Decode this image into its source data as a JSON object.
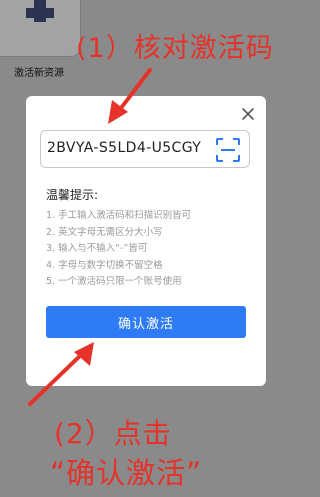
{
  "background": {
    "tile_label": "激活新资源"
  },
  "annotations": {
    "step1": "(1）核对激活码",
    "step2_line1": "(2）点击",
    "step2_line2": "“确认激活”"
  },
  "modal": {
    "code_value": "2BVYA-S5LD4-U5CGY",
    "tips_title": "温馨提示:",
    "tips": [
      "1. 手工输入激活码和扫描识别皆可",
      "2. 英文字母无需区分大小写",
      "3. 输入与不输入“-”皆可",
      "4. 字母与数字切换不留空格",
      "5. 一个激活码只限一个账号使用"
    ],
    "confirm_label": "确认激活"
  },
  "colors": {
    "annotation": "#e5332a",
    "primary": "#2f7bf5",
    "scan_icon": "#2f7bf5",
    "backdrop": "#8a8a8a"
  },
  "icons": {
    "close": "close-icon",
    "scan": "scan-icon",
    "add": "plus-icon"
  }
}
